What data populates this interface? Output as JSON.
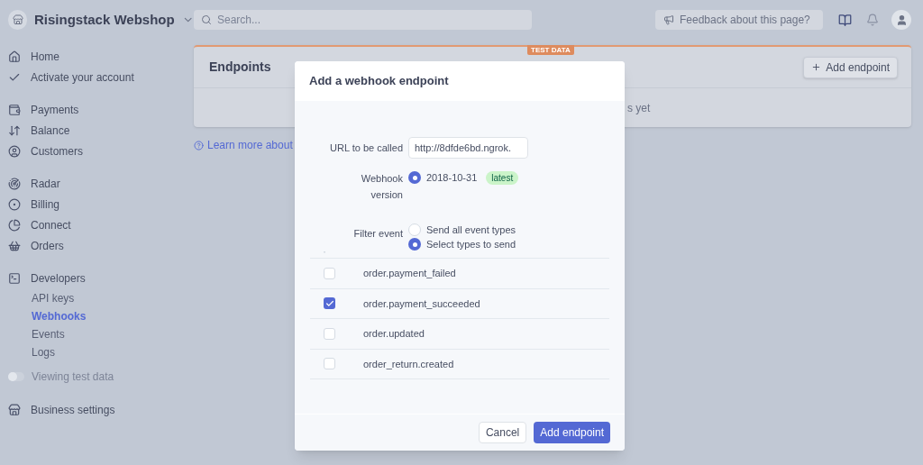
{
  "workspace": {
    "name": "Risingstack Webshop"
  },
  "search": {
    "placeholder": "Search..."
  },
  "feedback": {
    "label": "Feedback about this page?"
  },
  "sidebar": {
    "sections": [
      {
        "items": [
          {
            "label": "Home",
            "selected": false
          },
          {
            "label": "Activate your account",
            "selected": false
          }
        ]
      },
      {
        "items": [
          {
            "label": "Payments",
            "selected": false
          },
          {
            "label": "Balance",
            "selected": false
          },
          {
            "label": "Customers",
            "selected": false
          }
        ]
      },
      {
        "items": [
          {
            "label": "Radar",
            "selected": false
          },
          {
            "label": "Billing",
            "selected": false
          },
          {
            "label": "Connect",
            "selected": false
          },
          {
            "label": "Orders",
            "selected": false
          }
        ]
      },
      {
        "items": [
          {
            "label": "Developers",
            "selected": false,
            "children": [
              {
                "label": "API keys",
                "selected": false
              },
              {
                "label": "Webhooks",
                "selected": true
              },
              {
                "label": "Events",
                "selected": false
              },
              {
                "label": "Logs",
                "selected": false
              }
            ]
          }
        ]
      }
    ],
    "test_toggle": {
      "label": "Viewing test data",
      "on": false
    },
    "bottom_item": {
      "label": "Business settings",
      "selected": false
    }
  },
  "card": {
    "badge": "TEST DATA",
    "title": "Endpoints",
    "add_button": "Add endpoint",
    "empty_text": "s yet"
  },
  "learn_more": "Learn more about",
  "dialog": {
    "title": "Add a webhook endpoint",
    "url": {
      "label": "URL to be called",
      "value": "http://8dfde6bd.ngrok."
    },
    "version": {
      "label": "Webhook version",
      "options": [
        {
          "label": "2018-10-31",
          "badge": "latest",
          "selected": true
        }
      ]
    },
    "filter": {
      "label": "Filter event",
      "options": [
        {
          "label": "Send all event types",
          "selected": false
        },
        {
          "label": "Select types to send",
          "selected": true
        }
      ]
    },
    "events": [
      {
        "kind": "clipped",
        "checked": false
      },
      {
        "kind": "row",
        "label": "order.payment_failed",
        "checked": false
      },
      {
        "kind": "row",
        "label": "order.payment_succeeded",
        "checked": true
      },
      {
        "kind": "row",
        "label": "order.updated",
        "checked": false
      },
      {
        "kind": "row",
        "label": "order_return.created",
        "checked": false
      }
    ],
    "buttons": {
      "cancel": "Cancel",
      "submit": "Add endpoint"
    }
  }
}
